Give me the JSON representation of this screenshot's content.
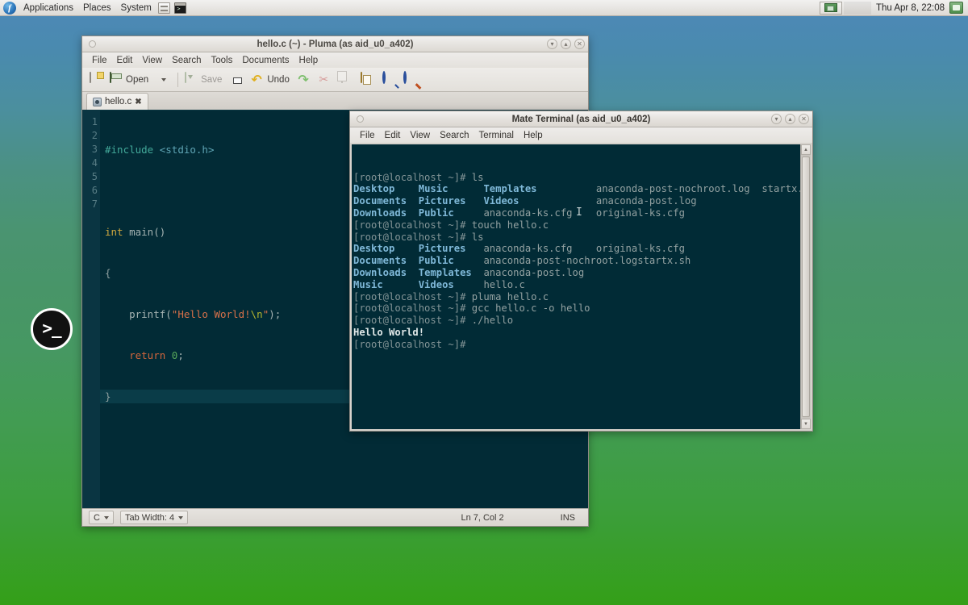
{
  "panel": {
    "logo": "firefox-logo-icon",
    "menus": [
      "Applications",
      "Places",
      "System"
    ],
    "launchers": [
      "file-manager-icon",
      "terminal-icon"
    ],
    "clock": "Thu Apr  8, 22:08"
  },
  "desktop": {
    "icon_label": ">_",
    "icon_name": "terminal-desktop-icon",
    "bg_top": "#4d88b8",
    "bg_bottom": "#349f18"
  },
  "pluma": {
    "title": "hello.c (~) - Pluma (as aid_u0_a402)",
    "menus": [
      "File",
      "Edit",
      "View",
      "Search",
      "Tools",
      "Documents",
      "Help"
    ],
    "toolbar": {
      "new_label": "",
      "open_label": "Open",
      "save_label": "Save",
      "print_label": "",
      "undo_label": "Undo",
      "redo_label": "",
      "cut_label": "",
      "copy_label": "",
      "paste_label": "",
      "find_label": "",
      "replace_label": ""
    },
    "tab": {
      "label": "hello.c",
      "close": "✖"
    },
    "gutter": [
      "1",
      "2",
      "3",
      "4",
      "5",
      "6",
      "7"
    ],
    "code": {
      "l1_hash": "#include",
      "l1_inc": " <stdio.h>",
      "l2": "",
      "l3_kw": "int",
      "l3_fn": " main()",
      "l4": "{",
      "l5_fn": "    printf(",
      "l5_str": "\"Hello World!",
      "l5_esc": "\\n",
      "l5_str2": "\"",
      "l5_end": ");",
      "l6_ret": "    return",
      "l6_num": " 0",
      "l6_end": ";",
      "l7": "}"
    },
    "status": {
      "language": "C",
      "tab_width": "Tab Width: 4",
      "position": "Ln 7, Col 2",
      "mode": "INS"
    },
    "window_buttons": [
      "minimize-icon",
      "maximize-icon",
      "close-icon"
    ]
  },
  "terminal": {
    "title": "Mate Terminal (as aid_u0_a402)",
    "menus": [
      "File",
      "Edit",
      "View",
      "Search",
      "Terminal",
      "Help"
    ],
    "prompt": "[root@localhost ~]# ",
    "lines": [
      {
        "type": "cmd",
        "prompt": "[root@localhost ~]# ",
        "text": "ls"
      },
      {
        "type": "ls",
        "cells": [
          {
            "t": "Desktop",
            "dir": true
          },
          {
            "t": "Music",
            "dir": true
          },
          {
            "t": "Templates",
            "dir": true
          },
          {
            "t": "anaconda-post-nochroot.log",
            "dir": false
          },
          {
            "t": "startx.sh",
            "dir": false
          }
        ]
      },
      {
        "type": "ls",
        "cells": [
          {
            "t": "Documents",
            "dir": true
          },
          {
            "t": "Pictures",
            "dir": true
          },
          {
            "t": "Videos",
            "dir": true
          },
          {
            "t": "anaconda-post.log",
            "dir": false
          }
        ]
      },
      {
        "type": "ls",
        "cells": [
          {
            "t": "Downloads",
            "dir": true
          },
          {
            "t": "Public",
            "dir": true
          },
          {
            "t": "anaconda-ks.cfg",
            "dir": false
          },
          {
            "t": "original-ks.cfg",
            "dir": false
          }
        ]
      },
      {
        "type": "cmd",
        "prompt": "[root@localhost ~]# ",
        "text": "touch hello.c"
      },
      {
        "type": "cmd",
        "prompt": "[root@localhost ~]# ",
        "text": "ls"
      },
      {
        "type": "ls",
        "cells": [
          {
            "t": "Desktop",
            "dir": true
          },
          {
            "t": "Pictures",
            "dir": true
          },
          {
            "t": "anaconda-ks.cfg",
            "dir": false
          },
          {
            "t": "original-ks.cfg",
            "dir": false
          }
        ]
      },
      {
        "type": "ls",
        "cells": [
          {
            "t": "Documents",
            "dir": true
          },
          {
            "t": "Public",
            "dir": true
          },
          {
            "t": "anaconda-post-nochroot.log",
            "dir": false
          },
          {
            "t": "startx.sh",
            "dir": false
          }
        ]
      },
      {
        "type": "ls",
        "cells": [
          {
            "t": "Downloads",
            "dir": true
          },
          {
            "t": "Templates",
            "dir": true
          },
          {
            "t": "anaconda-post.log",
            "dir": false
          }
        ]
      },
      {
        "type": "ls",
        "cells": [
          {
            "t": "Music",
            "dir": true
          },
          {
            "t": "Videos",
            "dir": true
          },
          {
            "t": "hello.c",
            "dir": false
          }
        ]
      },
      {
        "type": "cmd",
        "prompt": "[root@localhost ~]# ",
        "text": "pluma hello.c"
      },
      {
        "type": "cmd",
        "prompt": "[root@localhost ~]# ",
        "text": "gcc hello.c -o hello"
      },
      {
        "type": "cmd",
        "prompt": "[root@localhost ~]# ",
        "text": "./hello"
      },
      {
        "type": "out",
        "text": "Hello World!"
      },
      {
        "type": "cmd",
        "prompt": "[root@localhost ~]# ",
        "text": ""
      }
    ],
    "text_rows": [
      "[root@localhost ~]# ls",
      "Desktop    Music     Templates      anaconda-post-nochroot.log  startx.sh",
      "Documents  Pictures  Videos         anaconda-post.log",
      "Downloads  Public    anaconda-ks.cfg  original-ks.cfg",
      "[root@localhost ~]# touch hello.c",
      "[root@localhost ~]# ls",
      "Desktop    Pictures   anaconda-ks.cfg             original-ks.cfg",
      "Documents  Public     anaconda-post-nochroot.log  startx.sh",
      "Downloads  Templates  anaconda-post.log",
      "Music      Videos     hello.c",
      "[root@localhost ~]# pluma hello.c",
      "[root@localhost ~]# gcc hello.c -o hello",
      "[root@localhost ~]# ./hello",
      "Hello World!",
      "[root@localhost ~]# "
    ],
    "window_buttons": [
      "minimize-icon",
      "maximize-icon",
      "close-icon"
    ],
    "bg_color": "#012b36",
    "fg_color": "#93a1a1",
    "dir_color": "#7fb8d8"
  }
}
